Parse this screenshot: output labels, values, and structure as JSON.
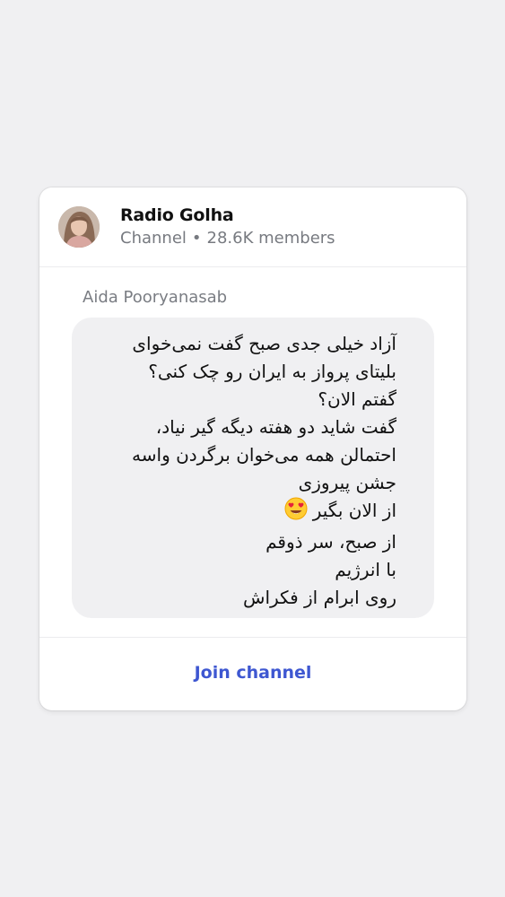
{
  "channel": {
    "name": "Radio Golha",
    "type_label": "Channel",
    "separator": "•",
    "members": "28.6K members"
  },
  "post": {
    "author": "Aida Pooryanasab",
    "lines": [
      "آزاد خیلی جدی صبح گفت نمی‌خوای",
      "بلیتای پرواز به ایران رو چک کنی؟",
      "گفتم الان؟",
      "گفت شاید دو هفته دیگه گیر نیاد،",
      "احتمالن همه می‌خوان برگردن واسه",
      "جشن پیروزی",
      "از الان بگیر",
      "از صبح، سر ذوقم",
      "با انرژیم",
      "روی ابرام از فکراش"
    ],
    "emoji_icon": "heart-eyes-emoji-icon"
  },
  "footer": {
    "join_label": "Join channel"
  },
  "colors": {
    "accent": "#3e57d1",
    "bubble": "#f0f0f2",
    "muted_text": "#777a80",
    "page_background": "#f0f0f2"
  }
}
